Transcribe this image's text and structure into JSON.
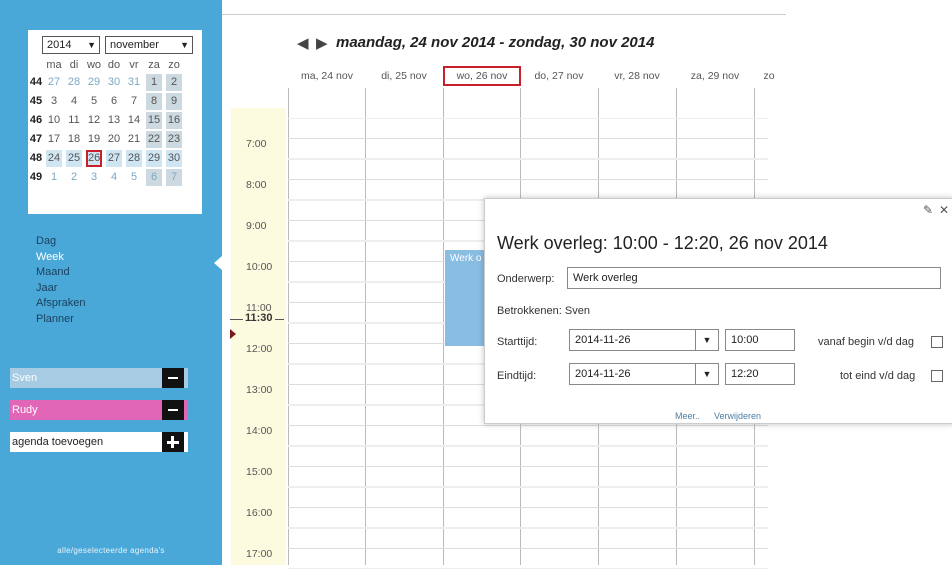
{
  "minical": {
    "year": "2014",
    "month": "november",
    "weekday_headers": [
      "ma",
      "di",
      "wo",
      "do",
      "vr",
      "za",
      "zo"
    ],
    "weeks": [
      {
        "nr": "44",
        "days": [
          "27",
          "28",
          "29",
          "30",
          "31",
          "1",
          "2"
        ]
      },
      {
        "nr": "45",
        "days": [
          "3",
          "4",
          "5",
          "6",
          "7",
          "8",
          "9"
        ]
      },
      {
        "nr": "46",
        "days": [
          "10",
          "11",
          "12",
          "13",
          "14",
          "15",
          "16"
        ]
      },
      {
        "nr": "47",
        "days": [
          "17",
          "18",
          "19",
          "20",
          "21",
          "22",
          "23"
        ]
      },
      {
        "nr": "48",
        "days": [
          "24",
          "25",
          "26",
          "27",
          "28",
          "29",
          "30"
        ]
      },
      {
        "nr": "49",
        "days": [
          "1",
          "2",
          "3",
          "4",
          "5",
          "6",
          "7"
        ]
      }
    ],
    "today": "26"
  },
  "nav": {
    "items": [
      "Dag",
      "Week",
      "Maand",
      "Jaar",
      "Afspraken",
      "Planner"
    ],
    "active": "Week"
  },
  "agendas": [
    {
      "name": "Sven",
      "color": "#a6cbe2"
    },
    {
      "name": "Rudy",
      "color": "#e266b8"
    }
  ],
  "add_agenda": "agenda toevoegen",
  "footer": "alle/geselecteerde agenda's",
  "week_title": "maandag, 24 nov 2014 - zondag, 30 nov 2014",
  "days": [
    "ma, 24 nov",
    "di, 25 nov",
    "wo, 26 nov",
    "do, 27 nov",
    "vr, 28 nov",
    "za, 29 nov",
    "zo"
  ],
  "today_day": "wo, 26 nov",
  "hours": [
    "7:00",
    "8:00",
    "9:00",
    "10:00",
    "11:00",
    "12:00",
    "13:00",
    "14:00",
    "15:00",
    "16:00",
    "17:00"
  ],
  "current_time": "11:30",
  "event": {
    "title": "Werk o"
  },
  "popup": {
    "title": "Werk overleg: 10:00 - 12:20, 26 nov 2014",
    "subject_label": "Onderwerp:",
    "subject_value": "Werk overleg",
    "involved_label": "Betrokkenen:",
    "involved_value": "Sven",
    "start_label": "Starttijd:",
    "start_date": "2014-11-26",
    "start_time": "10:00",
    "from_start_label": "vanaf begin v/d dag",
    "end_label": "Eindtijd:",
    "end_date": "2014-11-26",
    "end_time": "12:20",
    "to_end_label": "tot eind v/d dag",
    "more_link": "Meer..",
    "delete_link": "Verwijderen"
  },
  "colors": {
    "sidebar": "#4aa8d8",
    "accent_red": "#c8202a",
    "event": "#89bde2",
    "gutter": "#fcfbe0"
  }
}
